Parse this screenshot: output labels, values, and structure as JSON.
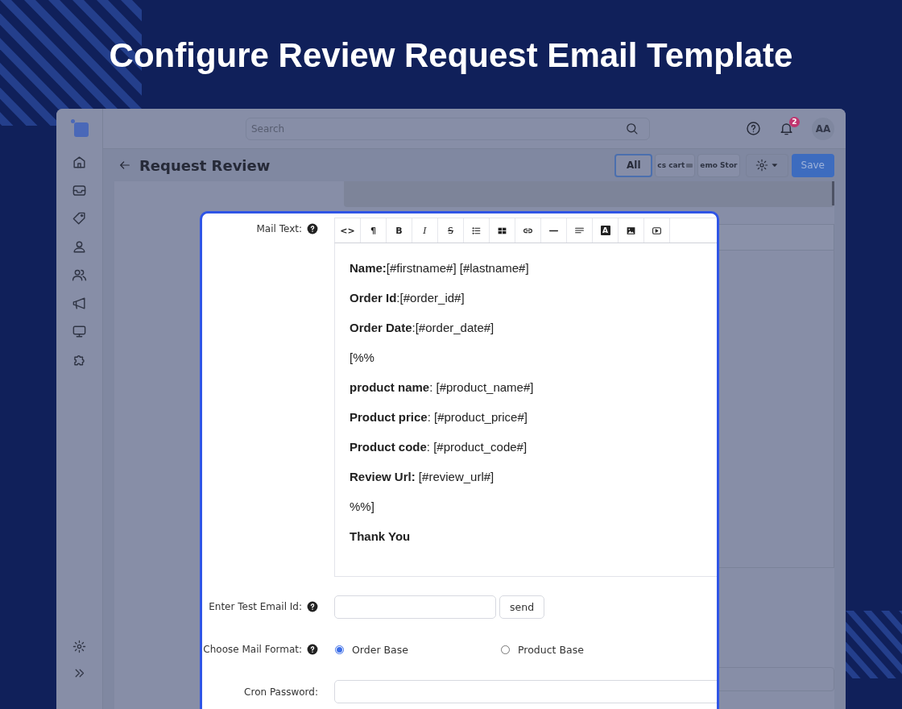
{
  "title": "Configure Review Request Email Template",
  "sidebar": {
    "items": [
      {
        "kind": "home"
      },
      {
        "kind": "inbox"
      },
      {
        "kind": "tag"
      },
      {
        "kind": "user"
      },
      {
        "kind": "users"
      },
      {
        "kind": "megaphone"
      },
      {
        "kind": "monitor"
      },
      {
        "kind": "puzzle"
      }
    ],
    "bottom": [
      {
        "kind": "gear"
      },
      {
        "kind": "chevrons"
      }
    ]
  },
  "topbar": {
    "search": {
      "placeholder": "Search"
    },
    "notifications": {
      "count": "2"
    },
    "avatar": {
      "initials": "AA"
    }
  },
  "header": {
    "title": "Request Review",
    "stores": [
      {
        "label": "All",
        "selected": true,
        "kind": "text"
      },
      {
        "label": "cs cart",
        "selected": false,
        "kind": "logo"
      },
      {
        "label": "emo Stor",
        "selected": false,
        "kind": "text"
      }
    ],
    "save": "Save"
  },
  "form": {
    "mail_text": {
      "label": "Mail Text:",
      "toolbar": [
        {
          "kind": "code",
          "glyph": "<>"
        },
        {
          "kind": "paragraph",
          "glyph": "¶"
        },
        {
          "kind": "bold",
          "glyph": "B"
        },
        {
          "kind": "italic",
          "glyph": "I"
        },
        {
          "kind": "strike",
          "glyph": "S"
        },
        {
          "kind": "bullets"
        },
        {
          "kind": "table"
        },
        {
          "kind": "link"
        },
        {
          "kind": "rule"
        },
        {
          "kind": "align"
        },
        {
          "kind": "color",
          "glyph": "A"
        },
        {
          "kind": "image"
        },
        {
          "kind": "video"
        }
      ],
      "lines": [
        {
          "kind": "plain",
          "text": "**Name:**[#firstname#] [#lastname#]"
        },
        {
          "kind": "plain",
          "text": "**Order Id**:[#order_id#]"
        },
        {
          "kind": "plain",
          "text": "**Order Date**:[#order_date#]"
        },
        {
          "kind": "plain",
          "text": "[%%"
        },
        {
          "kind": "plain",
          "text": "**product name**: [#product_name#]"
        },
        {
          "kind": "plain",
          "text": "**Product price**: [#product_price#]"
        },
        {
          "kind": "plain",
          "text": "**Product code**: [#product_code#]"
        },
        {
          "kind": "plain",
          "text": "**Review Url:** [#review_url#]"
        },
        {
          "kind": "plain",
          "text": "%%]"
        },
        {
          "kind": "strong",
          "text": "Thank You"
        }
      ]
    },
    "test_email": {
      "label": "Enter Test Email Id:",
      "button": "send"
    },
    "mail_format": {
      "label": "Choose Mail Format:",
      "options": [
        {
          "label": "Order Base",
          "selected": true
        },
        {
          "label": "Product Base",
          "selected": false
        }
      ]
    },
    "cron_password": {
      "label": "Cron Password:"
    }
  }
}
